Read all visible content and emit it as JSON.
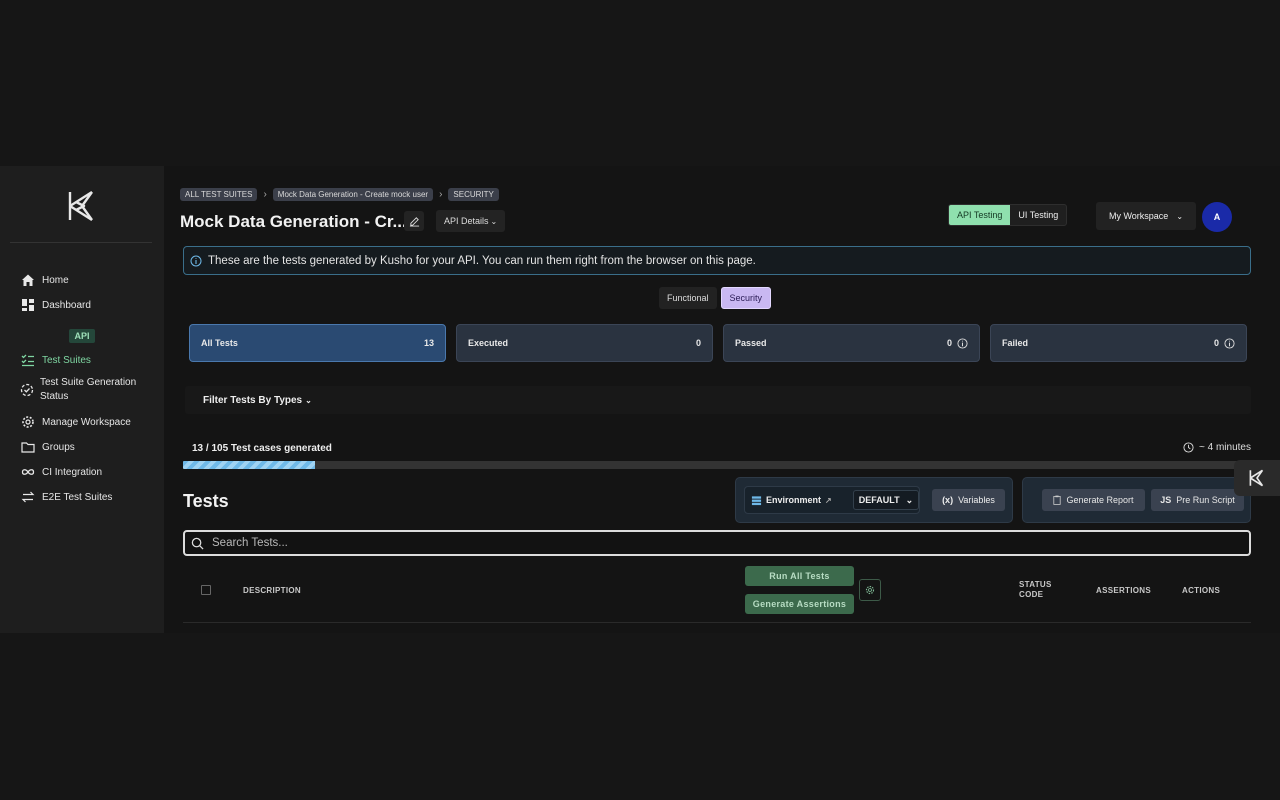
{
  "sidebar": {
    "items": [
      {
        "label": "Home",
        "icon": "home-icon"
      },
      {
        "label": "Dashboard",
        "icon": "dashboard-icon"
      },
      {
        "label": "Test Suites",
        "icon": "checklist-icon"
      },
      {
        "label": "Test Suite Generation Status",
        "icon": "progress-circle-icon"
      },
      {
        "label": "Manage Workspace",
        "icon": "gear-icon"
      },
      {
        "label": "Groups",
        "icon": "folder-icon"
      },
      {
        "label": "CI Integration",
        "icon": "infinity-icon"
      },
      {
        "label": "E2E Test Suites",
        "icon": "arrows-icon"
      }
    ],
    "section_label": "API"
  },
  "breadcrumbs": [
    "ALL TEST SUITES",
    "Mock Data Generation - Create mock user",
    "SECURITY"
  ],
  "header": {
    "title": "Mock Data Generation - Cr...",
    "api_details": "API Details",
    "mode_options": [
      "API Testing",
      "UI Testing"
    ],
    "workspace": "My Workspace",
    "avatar_initial": "A"
  },
  "info_message": "These are the tests generated by Kusho for your API. You can run them right from the browser on this page.",
  "type_options": [
    "Functional",
    "Security"
  ],
  "stats": [
    {
      "label": "All Tests",
      "value": "13"
    },
    {
      "label": "Executed",
      "value": "0"
    },
    {
      "label": "Passed",
      "value": "0"
    },
    {
      "label": "Failed",
      "value": "0"
    }
  ],
  "filter_label": "Filter Tests By Types",
  "generation": {
    "label": "13 / 105 Test cases generated",
    "eta": "~ 4 minutes",
    "progress_fraction": 0.1238
  },
  "tests": {
    "heading": "Tests",
    "environment_label": "Environment",
    "environment_value": "DEFAULT",
    "variables_label": "Variables",
    "generate_report": "Generate Report",
    "pre_run_script": "Pre Run Script",
    "search_placeholder": "Search Tests...",
    "columns": {
      "description": "DESCRIPTION",
      "status_code": "STATUS CODE",
      "assertions": "ASSERTIONS",
      "actions": "ACTIONS"
    },
    "run_all": "Run All Tests",
    "generate_assertions": "Generate Assertions"
  },
  "colors": {
    "accent_green": "#8fe0ae",
    "accent_purple": "#c9b8f2",
    "selected_card": "#2a4a72",
    "info_border": "#3a6e8a"
  }
}
